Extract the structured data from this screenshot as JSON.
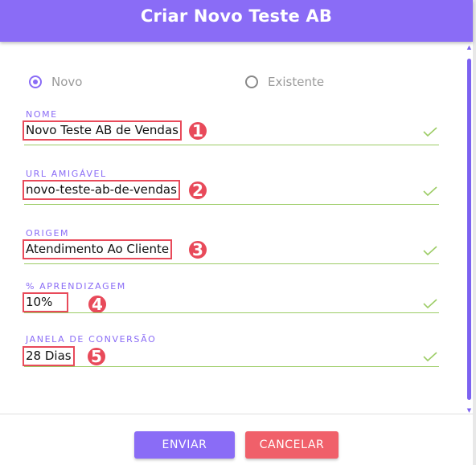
{
  "dialog": {
    "title": "Criar Novo Teste AB"
  },
  "mode": {
    "options": [
      {
        "label": "Novo",
        "selected": true
      },
      {
        "label": "Existente",
        "selected": false
      }
    ]
  },
  "fields": [
    {
      "label": "NOME",
      "value": "Novo Teste AB de Vendas",
      "badge": "1",
      "valid": true
    },
    {
      "label": "URL AMIGÁVEL",
      "value": "novo-teste-ab-de-vendas",
      "badge": "2",
      "valid": true
    },
    {
      "label": "ORIGEM",
      "value": "Atendimento Ao Cliente",
      "badge": "3",
      "valid": true
    },
    {
      "label": "% APRENDIZAGEM",
      "value": "10%",
      "badge": "4",
      "valid": true
    },
    {
      "label": "JANELA DE CONVERSÃO",
      "value": "28 Dias",
      "badge": "5",
      "valid": true
    }
  ],
  "actions": {
    "submit_label": "ENVIAR",
    "cancel_label": "CANCELAR"
  },
  "colors": {
    "accent": "#8a6cf6",
    "cancel": "#f0606a",
    "highlight": "#e84a5a",
    "valid": "#9ccc65"
  },
  "icons": {
    "valid": "check-icon",
    "radio": "radio-icon"
  }
}
